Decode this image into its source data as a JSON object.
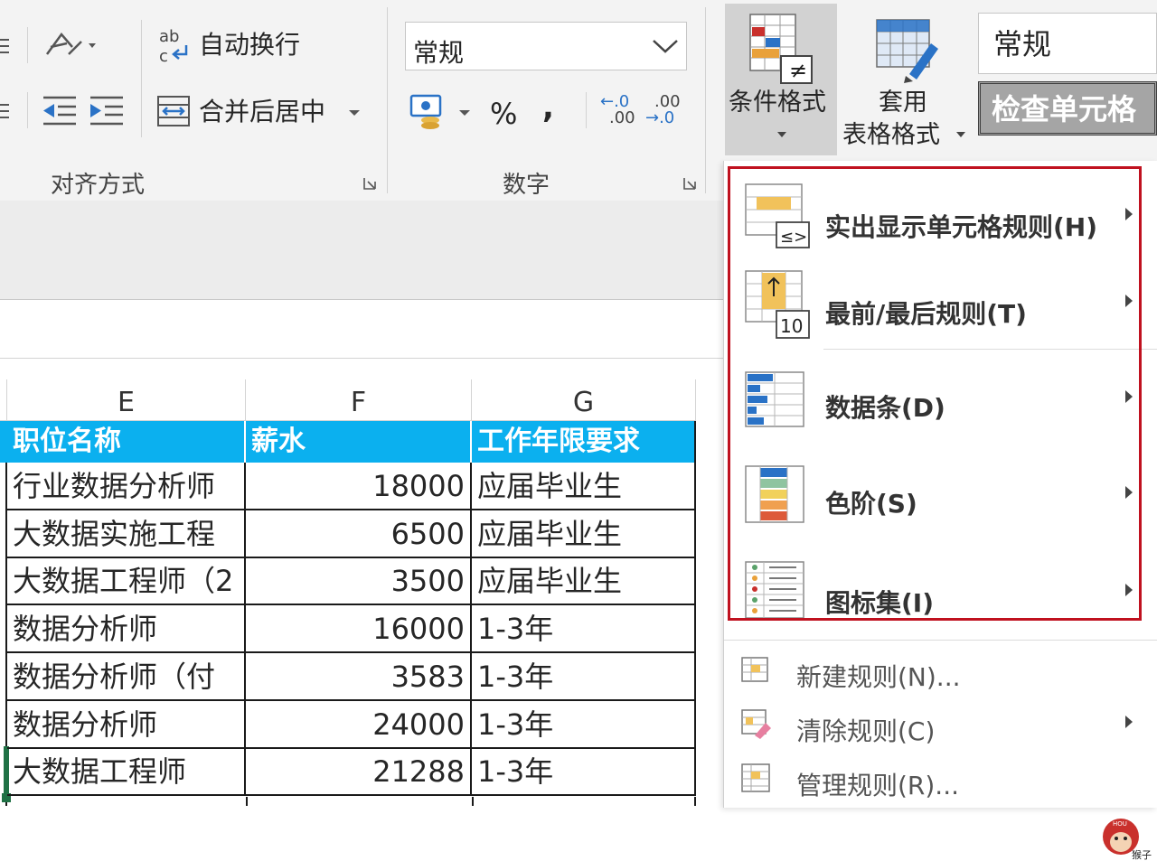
{
  "ribbon": {
    "wrap_text": "自动换行",
    "merge_center": "合并后居中",
    "align_group": "对齐方式",
    "number_group": "数字",
    "number_format": "常规",
    "percent": "%",
    "comma": ",",
    "inc_decimal_top": "←.0",
    "inc_decimal_bottom": ".00",
    "dec_decimal_top": ".00",
    "dec_decimal_bottom": "→.0",
    "cond_format_label": "条件格式",
    "table_format_line1": "套用",
    "table_format_line2": "表格格式",
    "style_normal": "常规",
    "style_check_cell": "检查单元格"
  },
  "sheet": {
    "col_e": "E",
    "col_f": "F",
    "col_g": "G",
    "headers": [
      "职位名称",
      "薪水",
      "工作年限要求"
    ],
    "rows": [
      {
        "title": "行业数据分析师",
        "salary": "18000",
        "years": "应届毕业生"
      },
      {
        "title": "大数据实施工程",
        "salary": "6500",
        "years": "应届毕业生"
      },
      {
        "title": "大数据工程师（2",
        "salary": "3500",
        "years": "应届毕业生"
      },
      {
        "title": "数据分析师",
        "salary": "16000",
        "years": "1-3年"
      },
      {
        "title": "数据分析师（付",
        "salary": "3583",
        "years": "1-3年"
      },
      {
        "title": "数据分析师",
        "salary": "24000",
        "years": "1-3年"
      },
      {
        "title": "大数据工程师",
        "salary": "21288",
        "years": "1-3年"
      }
    ]
  },
  "menu": {
    "highlight_rules": "实出显示单元格规则(H)",
    "top_bottom_rules": "最前/最后规则(T)",
    "data_bars": "数据条(D)",
    "color_scales": "色阶(S)",
    "icon_sets": "图标集(I)",
    "new_rule": "新建规则(N)...",
    "clear_rules": "清除规则(C)",
    "manage_rules": "管理规则(R)...",
    "top10_badge": "10"
  },
  "watermark": {
    "text": "猴子"
  },
  "colors": {
    "header_fill": "#0bb0ef",
    "highlight_border": "#c0111f",
    "ribbon_bg": "#f3f3f3"
  }
}
